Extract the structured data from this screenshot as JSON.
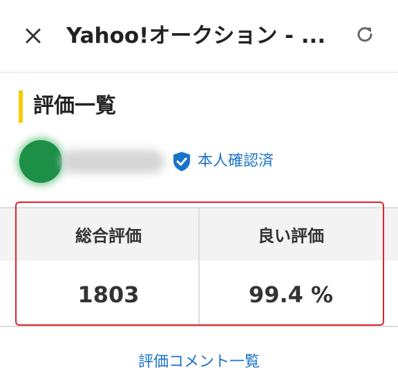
{
  "appbar": {
    "title": "Yahoo!オークション - ...",
    "close_icon": "close-icon",
    "reload_icon": "reload-icon"
  },
  "heading": {
    "title": "評価一覧",
    "accent_color": "#f5cc00"
  },
  "user": {
    "verified_label": "本人確認済",
    "verified_icon": "shield-check-icon",
    "avatar_color": "#1e8f47"
  },
  "ratings": {
    "total_label": "総合評価",
    "total_value": "1803",
    "good_label": "良い評価",
    "good_value": "99.4 %"
  },
  "links": {
    "comments": "評価コメント一覧"
  },
  "colors": {
    "link": "#1a73c9",
    "highlight": "#e0202a"
  }
}
